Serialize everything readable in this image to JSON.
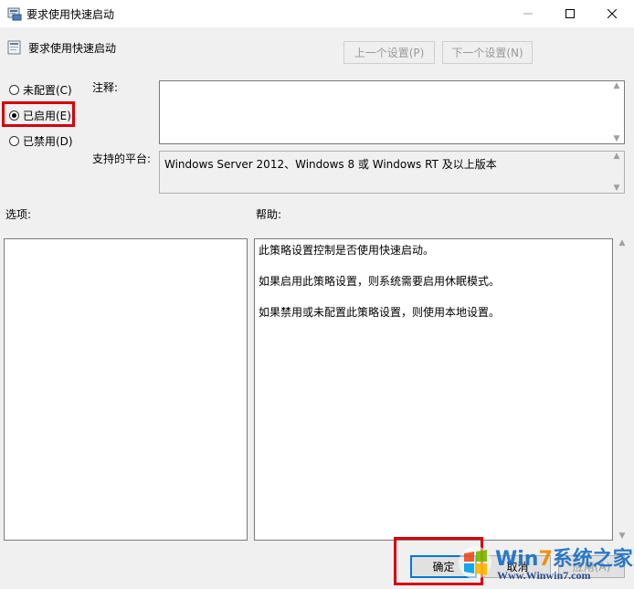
{
  "window": {
    "title": "要求使用快速启动",
    "controls": {
      "minimize": "—",
      "maximize": "☐",
      "close": "✕"
    }
  },
  "header": {
    "setting_name": "要求使用快速启动",
    "prev_button": "上一个设置(P)",
    "next_button": "下一个设置(N)"
  },
  "state": {
    "options": [
      {
        "label": "未配置(C)",
        "checked": false
      },
      {
        "label": "已启用(E)",
        "checked": true
      },
      {
        "label": "已禁用(D)",
        "checked": false
      }
    ]
  },
  "comment": {
    "label": "注释:",
    "value": ""
  },
  "platform": {
    "label": "支持的平台:",
    "value": "Windows Server 2012、Windows 8 或 Windows RT 及以上版本"
  },
  "options_panel": {
    "label": "选项:"
  },
  "help_panel": {
    "label": "帮助:",
    "lines": [
      "此策略设置控制是否使用快速启动。",
      "如果启用此策略设置，则系统需要启用休眠模式。",
      "如果禁用或未配置此策略设置，则使用本地设置。"
    ]
  },
  "footer": {
    "ok": "确定",
    "cancel": "取消",
    "apply": "应用(A)"
  },
  "watermark": {
    "title_a": "Win",
    "title_b": "7",
    "title_c": "系统之家",
    "url": "Www.Winwin7.com"
  },
  "colors": {
    "highlight": "#d4000a",
    "accent": "#0078d7"
  }
}
